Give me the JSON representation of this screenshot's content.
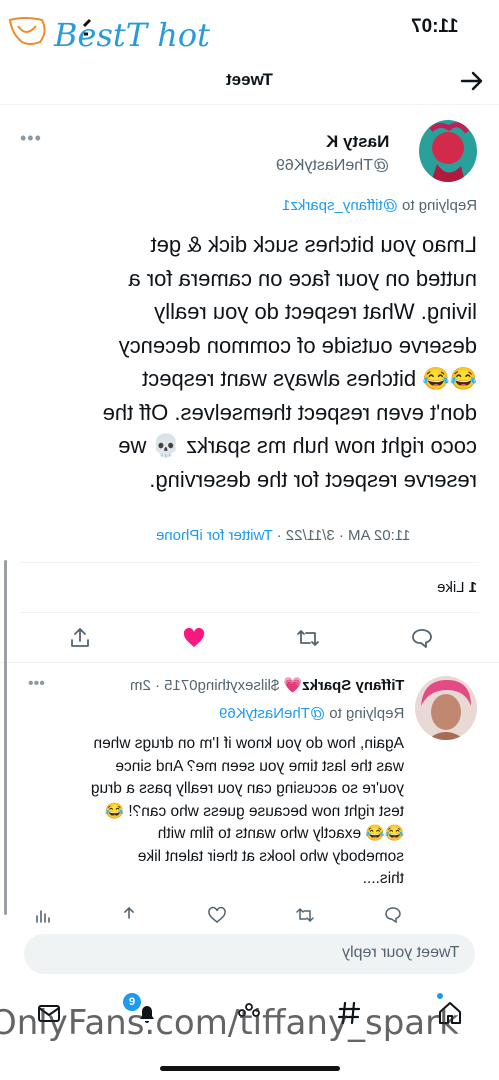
{
  "status_bar": {
    "time": "11:07"
  },
  "watermark": {
    "logo_text": "BestT hot",
    "url": "OnlyFans.com/tiffany_spark"
  },
  "header": {
    "title": "Tweet"
  },
  "tweet": {
    "author_name": "Nasty K",
    "author_handle": "@TheNastyK69",
    "replying_prefix": "Replying to ",
    "replying_to": "@tiffany_sparkz1",
    "body_lines": [
      "Lmao you bitches suck dick & get",
      "nutted on your face on camera for a",
      "living. What respect do you really",
      "deserve outside of common decency",
      "😂😂 bitches always want respect",
      "don't even respect themselves. Off the",
      "coco right now huh ms sparkz 💀 we",
      "reserve respect for the deserving."
    ],
    "time": "11:02 AM",
    "date": "3/11/22",
    "source": "Twitter for iPhone",
    "likes_count": "1",
    "likes_label": "Like",
    "liked": true
  },
  "reply": {
    "author_name": "Tiffany Sparkz💗",
    "author_handle": "$lilsexything0715",
    "age": "2m",
    "replying_prefix": "Replying to ",
    "replying_to": "@TheNastyK69",
    "body_lines": [
      "Again, how do you know if I'm on drugs when",
      "was the last time you seen me? And since",
      "you're so accusing can you really pass a drug",
      "test right now because guess who can?! 😂",
      "😂😂 exactly who wants to film with",
      "somebody who looks at their talent like",
      "this...."
    ]
  },
  "composer": {
    "placeholder": "Tweet your reply"
  },
  "tab_bar": {
    "notifications_badge": "9"
  },
  "colors": {
    "accent": "#1d9bf0",
    "like": "#f91880",
    "text": "#0f1419",
    "muted": "#536471"
  },
  "icons": [
    "back-arrow-icon",
    "more-icon",
    "reply-icon",
    "retweet-icon",
    "heart-icon",
    "share-icon",
    "analytics-icon",
    "home-icon",
    "search-icon",
    "spaces-icon",
    "notifications-icon",
    "messages-icon"
  ]
}
